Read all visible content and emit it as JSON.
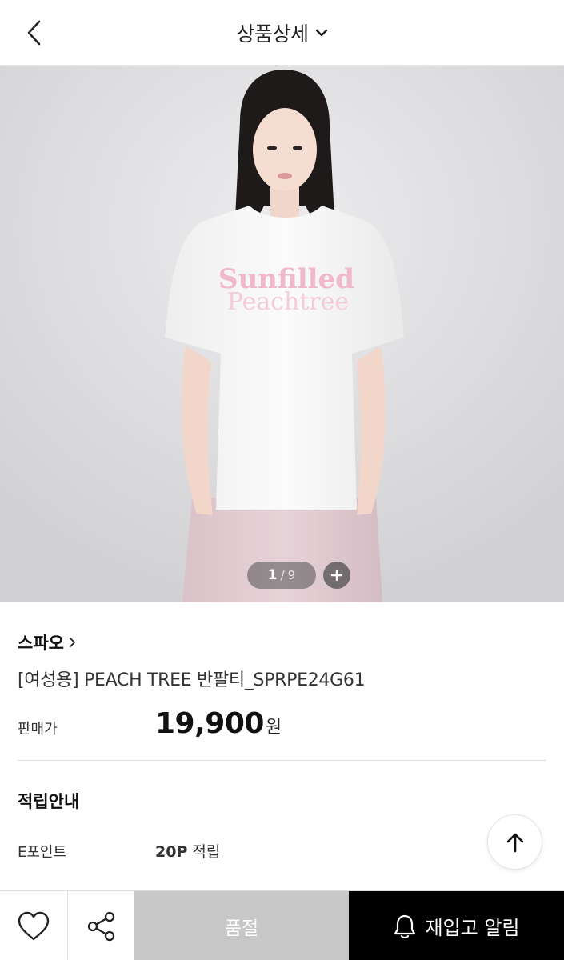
{
  "header": {
    "title": "상품상세"
  },
  "gallery": {
    "current": "1",
    "separator": "/",
    "total": "9",
    "shirt_print_line1": "Sunfilled",
    "shirt_print_line2": "Peachtree"
  },
  "product": {
    "brand": "스파오",
    "name": "[여성용] PEACH TREE 반팔티_SPRPE24G61",
    "price_label": "판매가",
    "price_value": "19,900",
    "price_unit": "원"
  },
  "points": {
    "title": "적립안내",
    "label": "E포인트",
    "amount": "20P",
    "suffix": "적립"
  },
  "bottom_bar": {
    "soldout_label": "품절",
    "restock_label": "재입고 알림"
  },
  "colors": {
    "soldout_bg": "#c7c7c7",
    "restock_bg": "#000000",
    "print_pink": "#f0b8c8"
  }
}
